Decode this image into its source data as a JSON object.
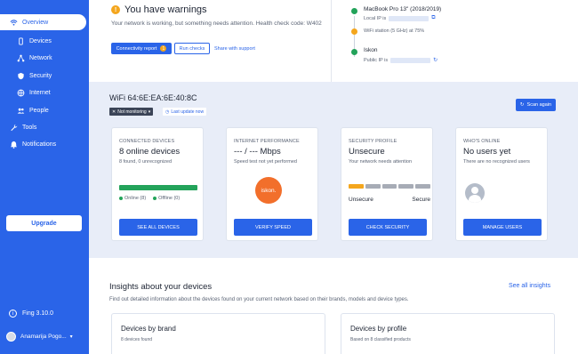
{
  "sidebar": {
    "items": [
      {
        "label": "Overview",
        "icon": "wifi-icon",
        "active": true
      },
      {
        "label": "Devices",
        "icon": "phone-icon"
      },
      {
        "label": "Network",
        "icon": "network-icon"
      },
      {
        "label": "Security",
        "icon": "shield-icon"
      },
      {
        "label": "Internet",
        "icon": "globe-icon"
      },
      {
        "label": "People",
        "icon": "people-icon"
      },
      {
        "label": "Tools",
        "icon": "wrench-icon"
      },
      {
        "label": "Notifications",
        "icon": "bell-icon"
      }
    ],
    "upgrade_label": "Upgrade",
    "version": "Fing 3.10.0",
    "user_name": "Anamarija Pogo..."
  },
  "warning": {
    "title": "You have warnings",
    "description": "Your network is working, but something needs attention. Health check code: W402",
    "connectivity_btn": "Connectivity report",
    "connectivity_count": "1",
    "run_checks_btn": "Run checks",
    "share_link": "Share with support"
  },
  "timeline": {
    "device_name": "MacBook Pro 13\" (2018/2019)",
    "local_ip_label": "Local IP is",
    "wifi_station": "WiFi station (5 GHz) at 75%",
    "isp_name": "Iskon",
    "public_ip_label": "Public IP is"
  },
  "wifi": {
    "title": "WiFi 64:6E:EA:6E:40:8C",
    "not_monitoring": "Not monitoring",
    "last_update": "Last update now",
    "scan_again": "Scan again"
  },
  "cards": {
    "devices": {
      "eyebrow": "CONNECTED DEVICES",
      "title": "8 online devices",
      "sub": "8 found, 0 unrecognized",
      "online_label": "Online (8)",
      "offline_label": "Offline (0)",
      "online_fraction": 1.0,
      "button": "SEE ALL DEVICES"
    },
    "internet": {
      "eyebrow": "INTERNET PERFORMANCE",
      "title": "--- / --- Mbps",
      "sub": "Speed test not yet performed",
      "isp_logo_text": "iskon.",
      "button": "VERIFY SPEED"
    },
    "security": {
      "eyebrow": "SECURITY PROFILE",
      "title": "Unsecure",
      "sub": "Your network needs attention",
      "low_label": "Unsecure",
      "high_label": "Secure",
      "level_segments": 1,
      "total_segments": 5,
      "button": "CHECK SECURITY"
    },
    "online": {
      "eyebrow": "WHO'S ONLINE",
      "title": "No users yet",
      "sub": "There are no recognized users",
      "button": "MANAGE USERS"
    }
  },
  "insights": {
    "title": "Insights about your devices",
    "see_all": "See all insights",
    "description": "Find out detailed information about the devices found on your current network based on their brands, models and device types.",
    "by_brand_title": "Devices by brand",
    "by_brand_sub": "8 devices found",
    "by_profile_title": "Devices by profile",
    "by_profile_sub": "Based on 8 classified products"
  },
  "colors": {
    "accent": "#2a64e8",
    "warning": "#f4a61d",
    "success": "#23a35a",
    "danger": "#e0342b",
    "isp_brand": "#f26f2b"
  }
}
